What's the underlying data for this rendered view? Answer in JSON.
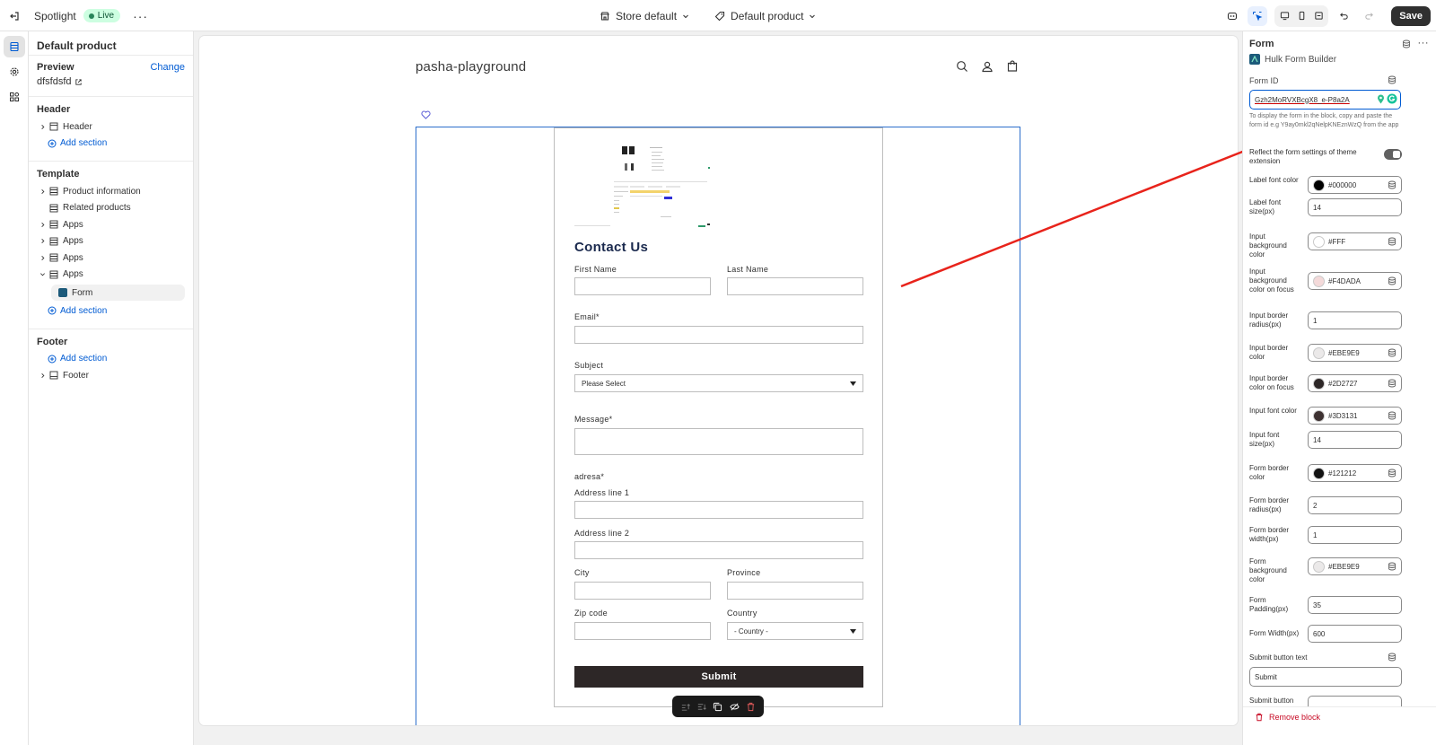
{
  "topbar": {
    "app_name": "Spotlight",
    "live_label": "Live",
    "store_select": "Store default",
    "template_select": "Default product",
    "save_label": "Save"
  },
  "sidebar": {
    "title": "Default product",
    "preview_label": "Preview",
    "change_label": "Change",
    "preview_value": "dfsfdsfd",
    "header_group": "Header",
    "header_item": "Header",
    "add_section": "Add section",
    "template_group": "Template",
    "template_items": [
      "Product information",
      "Related products",
      "Apps",
      "Apps",
      "Apps",
      "Apps"
    ],
    "form_block": "Form",
    "footer_group": "Footer",
    "footer_item": "Footer"
  },
  "canvas": {
    "store_name": "pasha-playground",
    "form": {
      "title": "Contact Us",
      "first_name": "First Name",
      "last_name": "Last Name",
      "email": "Email*",
      "subject": "Subject",
      "subject_select": "Please Select",
      "message": "Message*",
      "adresa": "adresa*",
      "address1": "Address line 1",
      "address2": "Address line 2",
      "city": "City",
      "province": "Province",
      "zip": "Zip code",
      "country": "Country",
      "country_select": "- Country -",
      "submit": "Submit"
    }
  },
  "right_panel": {
    "title": "Form",
    "app_name": "Hulk Form Builder",
    "form_id_label": "Form ID",
    "form_id_value": "Gzh2MoRVXBcgX8_e-P8a2A",
    "help_text": "To display the form in the block, copy and paste the form id e.g Y9ay0mkl2qNelpKNEznWzQ from the app",
    "reflect_label": "Reflect the form settings of theme extension",
    "settings": [
      {
        "label": "Label font color",
        "value": "#000000",
        "swatch": "#000000"
      },
      {
        "label": "Label font size(px)",
        "value": "14"
      },
      {
        "label": "Input background color",
        "value": "#FFF",
        "swatch": "#FFFFFF"
      },
      {
        "label": "Input background color on focus",
        "value": "#F4DADA",
        "swatch": "#F4DADA"
      },
      {
        "label": "Input border radius(px)",
        "value": "1"
      },
      {
        "label": "Input border color",
        "value": "#EBE9E9",
        "swatch": "#EBE9E9"
      },
      {
        "label": "Input border color on focus",
        "value": "#2D2727",
        "swatch": "#2D2727"
      },
      {
        "label": "Input font color",
        "value": "#3D3131",
        "swatch": "#3D3131"
      },
      {
        "label": "Input font size(px)",
        "value": "14"
      },
      {
        "label": "Form border color",
        "value": "#121212",
        "swatch": "#121212"
      },
      {
        "label": "Form border radius(px)",
        "value": "2"
      },
      {
        "label": "Form border width(px)",
        "value": "1"
      },
      {
        "label": "Form background color",
        "value": "#EBE9E9",
        "swatch": "#EBE9E9"
      },
      {
        "label": "Form Padding(px)",
        "value": "35"
      },
      {
        "label": "Form Width(px)",
        "value": "600"
      }
    ],
    "submit_text_label": "Submit button text",
    "submit_text_value": "Submit",
    "submit_button_label": "Submit button",
    "remove_block": "Remove block"
  },
  "colors": {
    "accent": "#005bd3",
    "annotation": "#e8231b",
    "submit_bg": "#2d2727",
    "danger": "#c70a24"
  }
}
